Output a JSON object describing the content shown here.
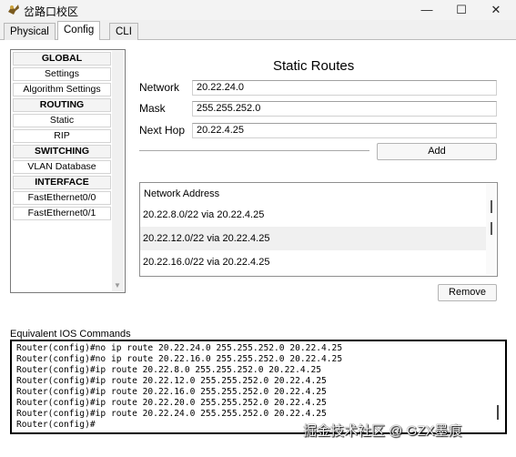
{
  "window": {
    "title": "岔路口校区",
    "controls": {
      "minimize": "—",
      "maximize": "☐",
      "close": "✕"
    }
  },
  "tabs": [
    {
      "label": "Physical",
      "active": false
    },
    {
      "label": "Config",
      "active": true
    },
    {
      "label": "CLI",
      "active": false
    }
  ],
  "nav": {
    "items": [
      {
        "label": "GLOBAL",
        "section": true
      },
      {
        "label": "Settings",
        "section": false
      },
      {
        "label": "Algorithm Settings",
        "section": false
      },
      {
        "label": "ROUTING",
        "section": true
      },
      {
        "label": "Static",
        "section": false
      },
      {
        "label": "RIP",
        "section": false
      },
      {
        "label": "SWITCHING",
        "section": true
      },
      {
        "label": "VLAN Database",
        "section": false
      },
      {
        "label": "INTERFACE",
        "section": true
      },
      {
        "label": "FastEthernet0/0",
        "section": false
      },
      {
        "label": "FastEthernet0/1",
        "section": false
      }
    ]
  },
  "static_routes": {
    "title": "Static Routes",
    "network_label": "Network",
    "network_value": "20.22.24.0",
    "mask_label": "Mask",
    "mask_value": "255.255.252.0",
    "nexthop_label": "Next Hop",
    "nexthop_value": "20.22.4.25",
    "add_label": "Add",
    "remove_label": "Remove",
    "list_header": "Network Address",
    "routes": [
      "20.22.8.0/22 via 20.22.4.25",
      "20.22.12.0/22 via 20.22.4.25",
      "20.22.16.0/22 via 20.22.4.25"
    ]
  },
  "ios": {
    "title": "Equivalent IOS Commands",
    "lines": [
      "Router(config)#no ip route 20.22.24.0 255.255.252.0 20.22.4.25",
      "Router(config)#no ip route 20.22.16.0 255.255.252.0 20.22.4.25",
      "Router(config)#ip route 20.22.8.0 255.255.252.0 20.22.4.25",
      "Router(config)#ip route 20.22.12.0 255.255.252.0 20.22.4.25",
      "Router(config)#ip route 20.22.16.0 255.255.252.0 20.22.4.25",
      "Router(config)#ip route 20.22.20.0 255.255.252.0 20.22.4.25",
      "Router(config)#ip route 20.22.24.0 255.255.252.0 20.22.4.25",
      "Router(config)#"
    ]
  },
  "watermark": "掘金技术社区 @ GZX墨痕"
}
